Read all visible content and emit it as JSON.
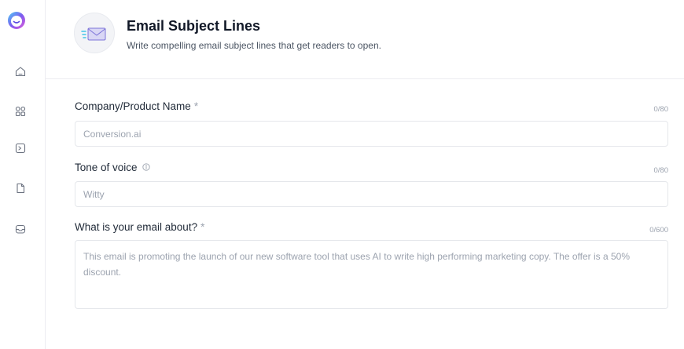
{
  "header": {
    "title": "Email Subject Lines",
    "subtitle": "Write compelling email subject lines that get readers to open."
  },
  "sidebar": {
    "logo": "jarvis-logo",
    "items": [
      {
        "icon": "home-icon"
      },
      {
        "icon": "grid-icon"
      },
      {
        "icon": "terminal-icon"
      },
      {
        "icon": "document-icon"
      },
      {
        "icon": "inbox-icon"
      }
    ]
  },
  "form": {
    "company": {
      "label": "Company/Product Name",
      "required_mark": "*",
      "counter": "0/80",
      "placeholder": "Conversion.ai"
    },
    "tone": {
      "label": "Tone of voice",
      "counter": "0/80",
      "placeholder": "Witty"
    },
    "about": {
      "label": "What is your email about?",
      "required_mark": "*",
      "counter": "0/600",
      "placeholder": "This email is promoting the launch of our new software tool that uses AI to write high performing marketing copy. The offer is a 50% discount."
    }
  },
  "colors": {
    "accent": "#5b4ce0",
    "border": "#e5e7eb",
    "muted": "#9ca3af"
  }
}
